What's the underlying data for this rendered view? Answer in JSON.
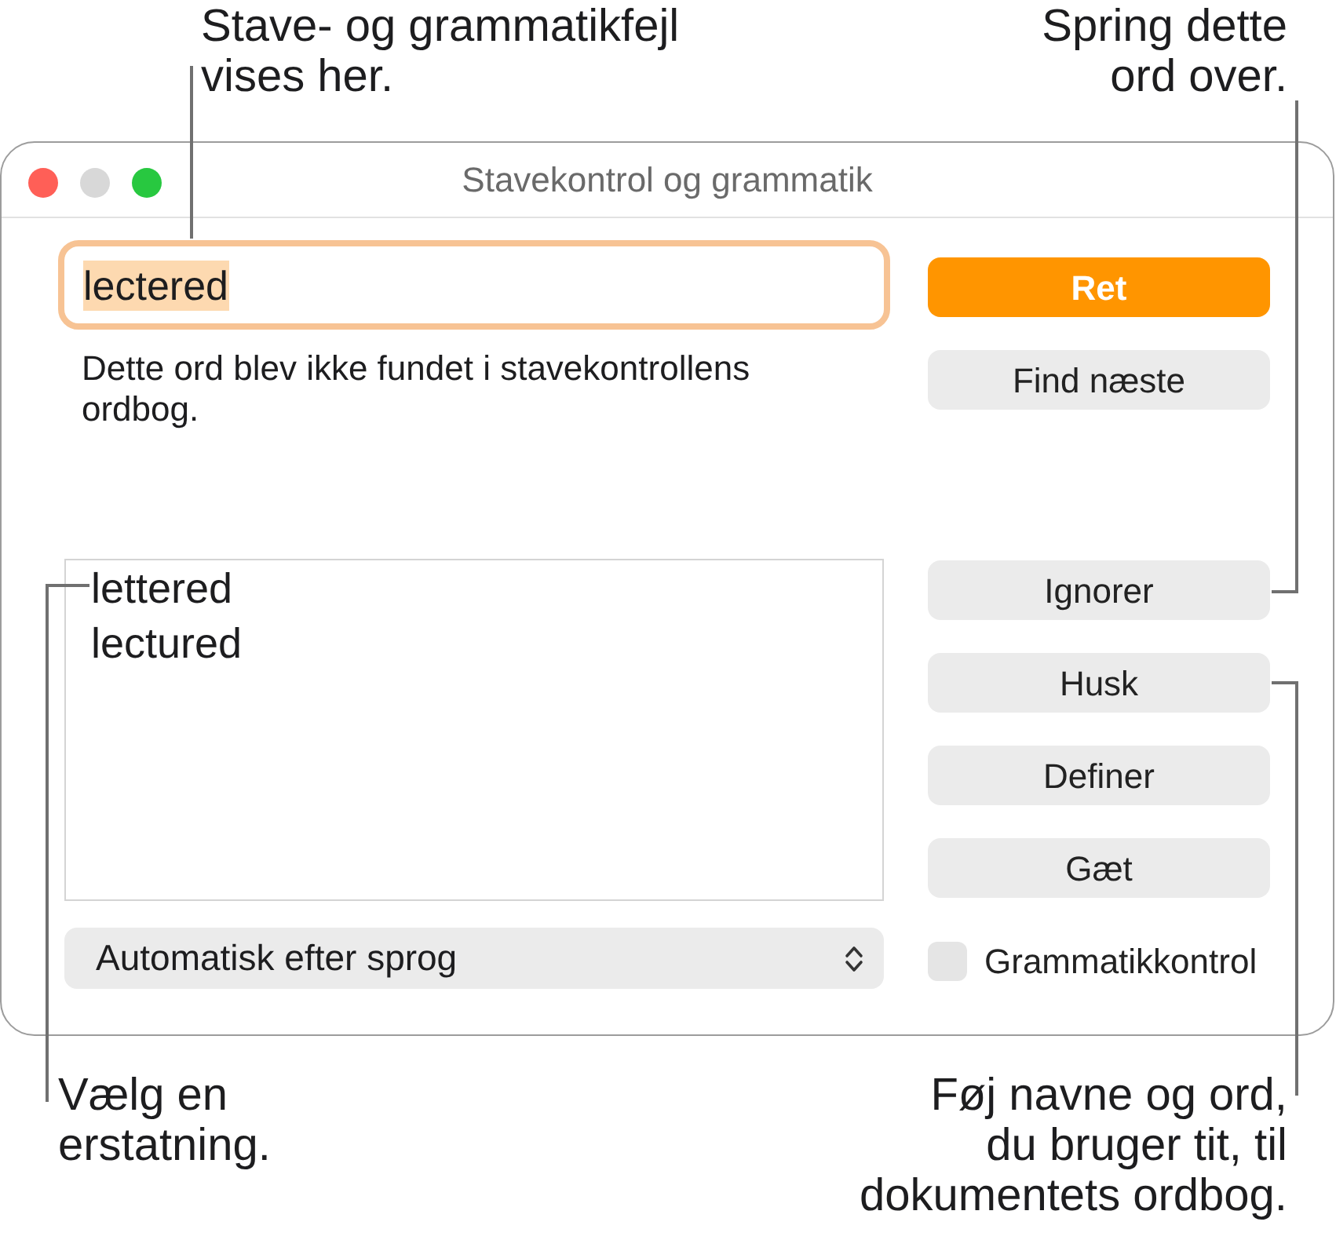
{
  "callouts": {
    "top_left": {
      "lines": [
        "Stave- og grammatikfejl",
        "vises her."
      ]
    },
    "top_right": {
      "lines": [
        "Spring dette",
        "ord over."
      ]
    },
    "bottom_left": {
      "lines": [
        "Vælg en",
        "erstatning."
      ]
    },
    "bottom_right": {
      "lines": [
        "Føj navne og ord,",
        "du bruger tit, til",
        "dokumentets ordbog."
      ]
    }
  },
  "window": {
    "title": "Stavekontrol og grammatik",
    "controls": [
      {
        "kind": "close",
        "disabled": false
      },
      {
        "kind": "minimize",
        "disabled": true
      },
      {
        "kind": "zoom",
        "disabled": false
      }
    ]
  },
  "field": {
    "value": "lectered",
    "focused": true,
    "text_selected": true
  },
  "message": "Dette ord blev ikke fundet i stavekontrollens ordbog.",
  "suggestions": [
    {
      "text": "lettered",
      "selected": false
    },
    {
      "text": "lectured",
      "selected": false
    }
  ],
  "language_popup": {
    "value": "Automatisk efter sprog"
  },
  "buttons_top": [
    {
      "label": "Ret",
      "default": true
    },
    {
      "label": "Find næste",
      "default": false
    }
  ],
  "buttons_bottom": [
    {
      "label": "Ignorer",
      "default": false
    },
    {
      "label": "Husk",
      "default": false
    },
    {
      "label": "Definer",
      "default": false
    },
    {
      "label": "Gæt",
      "default": false
    }
  ],
  "grammar_check": {
    "label": "Grammatikkontrol",
    "checked": false
  }
}
